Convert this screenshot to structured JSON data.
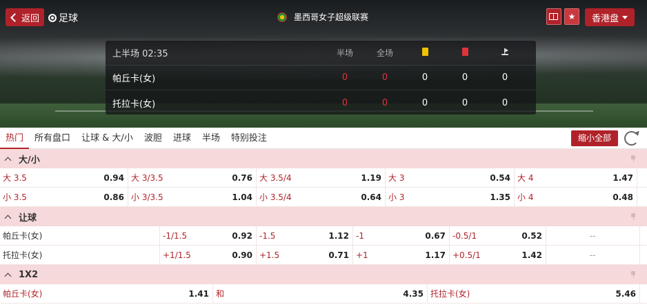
{
  "header": {
    "back_label": "返回",
    "sport_label": "足球",
    "league": "墨西哥女子超级联赛",
    "market_selector": "香港盘"
  },
  "scoreboard": {
    "period": "上半场 02:35",
    "col_half": "半场",
    "col_full": "全场",
    "teams": [
      {
        "name": "帕丘卡(女)",
        "half": "0",
        "full": "0",
        "yellow": "0",
        "red": "0",
        "corners": "0"
      },
      {
        "name": "托拉卡(女)",
        "half": "0",
        "full": "0",
        "yellow": "0",
        "red": "0",
        "corners": "0"
      }
    ]
  },
  "tabs": [
    "热门",
    "所有盘口",
    "让球 & 大/小",
    "波胆",
    "进球",
    "半场",
    "特别投注"
  ],
  "collapse_label": "缩小全部",
  "ou": {
    "title": "大/小",
    "over": [
      {
        "label": "大 3.5",
        "odds": "0.94"
      },
      {
        "label": "大 3/3.5",
        "odds": "0.76"
      },
      {
        "label": "大 3.5/4",
        "odds": "1.19"
      },
      {
        "label": "大 3",
        "odds": "0.54"
      },
      {
        "label": "大 4",
        "odds": "1.47"
      }
    ],
    "under": [
      {
        "label": "小 3.5",
        "odds": "0.86"
      },
      {
        "label": "小 3/3.5",
        "odds": "1.04"
      },
      {
        "label": "小 3.5/4",
        "odds": "0.64"
      },
      {
        "label": "小 3",
        "odds": "1.35"
      },
      {
        "label": "小 4",
        "odds": "0.48"
      }
    ]
  },
  "handicap": {
    "title": "让球",
    "rows": [
      {
        "team": "帕丘卡(女)",
        "lines": [
          {
            "label": "-1/1.5",
            "odds": "0.92"
          },
          {
            "label": "-1.5",
            "odds": "1.12"
          },
          {
            "label": "-1",
            "odds": "0.67"
          },
          {
            "label": "-0.5/1",
            "odds": "0.52"
          }
        ],
        "empty": "--"
      },
      {
        "team": "托拉卡(女)",
        "lines": [
          {
            "label": "+1/1.5",
            "odds": "0.90"
          },
          {
            "label": "+1.5",
            "odds": "0.71"
          },
          {
            "label": "+1",
            "odds": "1.17"
          },
          {
            "label": "+0.5/1",
            "odds": "1.42"
          }
        ],
        "empty": "--"
      }
    ]
  },
  "x12": {
    "title": "1X2",
    "home": {
      "label": "帕丘卡(女)",
      "odds": "1.41"
    },
    "draw": {
      "label": "和",
      "odds": "4.35"
    },
    "away": {
      "label": "托拉卡(女)",
      "odds": "5.46"
    }
  }
}
